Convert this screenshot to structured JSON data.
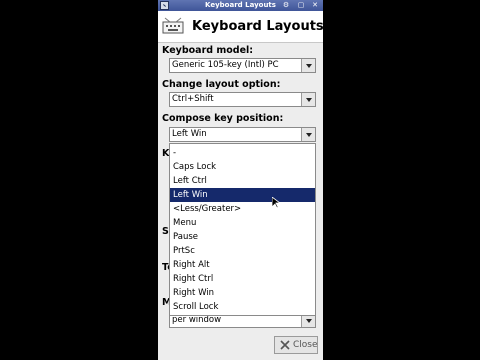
{
  "window": {
    "title": "Keyboard Layouts",
    "controls": [
      "⚙",
      "▢",
      "✕"
    ]
  },
  "header": {
    "title": "Keyboard Layouts"
  },
  "keyboard_model": {
    "label": "Keyboard model:",
    "value": "Generic 105-key (Intl) PC"
  },
  "change_layout": {
    "label": "Change layout option:",
    "value": "Ctrl+Shift"
  },
  "compose_key": {
    "label": "Compose key position:",
    "value": "Left Win",
    "options": [
      "-",
      "Caps Lock",
      "Left Ctrl",
      "Left Win",
      "<Less/Greater>",
      "Menu",
      "Pause",
      "PrtSc",
      "Right Alt",
      "Right Ctrl",
      "Right Win",
      "Scroll Lock"
    ],
    "selected_index": 3
  },
  "hidden_labels": {
    "k": "Ke",
    "s": "Sh",
    "t": "Te",
    "m": "M"
  },
  "bottom_combo": {
    "value": "per window"
  },
  "close_button": {
    "label": "Close"
  },
  "colors": {
    "selection": "#15296b",
    "titlebar": "#4a5fa3"
  }
}
